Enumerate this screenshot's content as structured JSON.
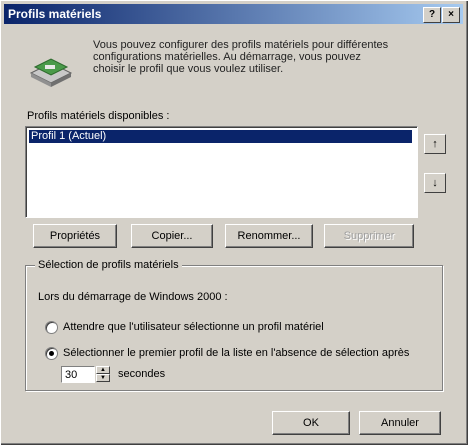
{
  "window": {
    "title": "Profils matériels",
    "help_button": "?",
    "close_button": "×"
  },
  "intro_text": "Vous pouvez configurer des profils matériels pour différentes configurations matérielles. Au démarrage, vous pouvez choisir le profil que vous voulez utiliser.",
  "profiles": {
    "label": "Profils matériels disponibles :",
    "items": [
      "Profil 1 (Actuel)"
    ],
    "move_up": "↑",
    "move_down": "↓"
  },
  "buttons": {
    "properties": "Propriétés",
    "copy": "Copier...",
    "rename": "Renommer...",
    "delete": "Supprimer"
  },
  "selection": {
    "group_label": "Sélection de profils matériels",
    "startup_text": "Lors du démarrage de Windows 2000 :",
    "option_wait": "Attendre que l'utilisateur sélectionne un profil matériel",
    "option_first": "Sélectionner le premier profil de la liste en l'absence de sélection après",
    "selected_option": "first",
    "timeout_value": "30",
    "timeout_unit": "secondes"
  },
  "dialog": {
    "ok": "OK",
    "cancel": "Annuler"
  }
}
